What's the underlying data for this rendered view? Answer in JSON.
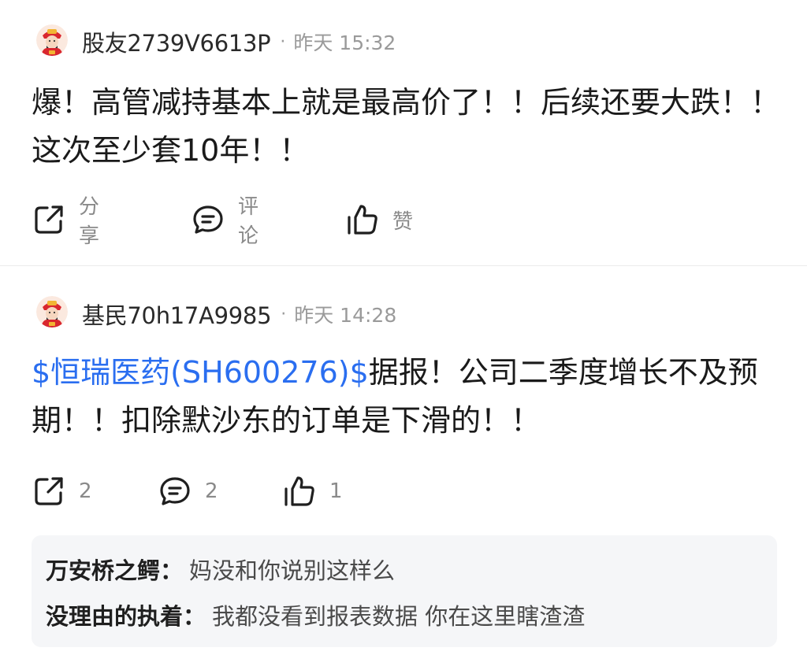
{
  "posts": [
    {
      "username": "股友2739V6613P",
      "separator": "·",
      "time": "昨天 15:32",
      "content": "爆！高管减持基本上就是最高价了！！后续还要大跌！！这次至少套10年！！",
      "actions": {
        "share": "分享",
        "comment": "评论",
        "like": "赞"
      }
    },
    {
      "username": "基民70h17A9985",
      "separator": "·",
      "time": "昨天 14:28",
      "stock_link": "$恒瑞医药(SH600276)$",
      "content": "据报！公司二季度增长不及预期！！扣除默沙东的订单是下滑的！！",
      "actions": {
        "share": "2",
        "comment": "2",
        "like": "1"
      },
      "replies": [
        {
          "author": "万安桥之鳄：",
          "text": "妈没和你说别这样么"
        },
        {
          "author": "没理由的执着：",
          "text": "我都没看到报表数据 你在这里瞎渣渣"
        }
      ]
    }
  ],
  "icons": {
    "avatar": "caishen-avatar-icon",
    "share": "share-icon",
    "comment": "comment-icon",
    "like": "thumbs-up-icon"
  },
  "colors": {
    "link": "#2a6ef0",
    "muted": "#9a9a9a",
    "reply_bg": "#f5f6f8"
  }
}
